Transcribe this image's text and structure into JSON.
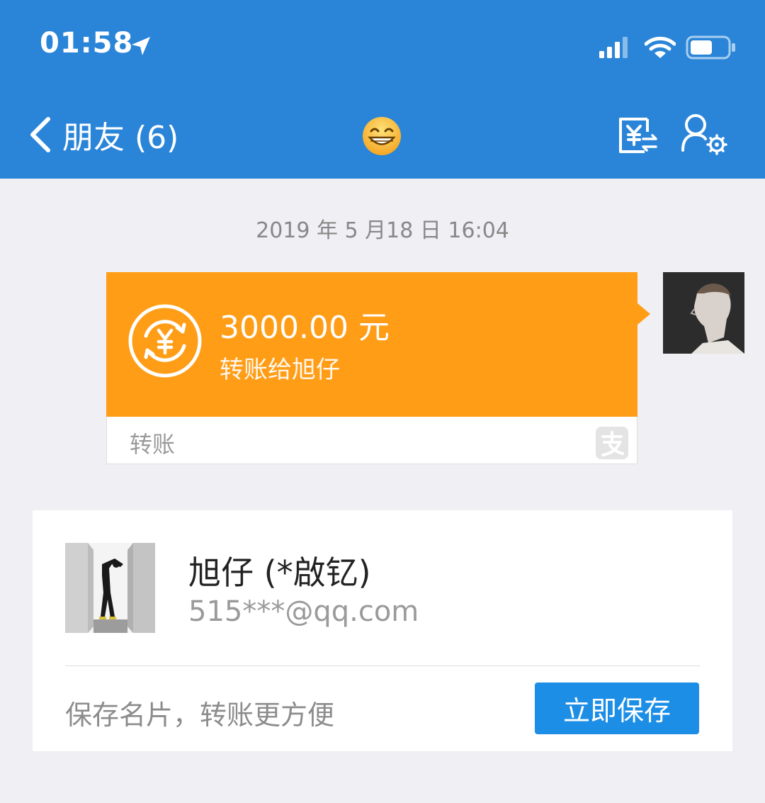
{
  "status_bar": {
    "time": "01:58",
    "icons": [
      "location-arrow-icon",
      "signal-icon",
      "wifi-icon",
      "battery-icon"
    ]
  },
  "nav": {
    "back_label": "朋友 (6)",
    "center_emoji": "😁",
    "right_icons": [
      "transfer-yuan-icon",
      "user-settings-icon"
    ]
  },
  "chat": {
    "timestamp": "2019 年 5 月18 日 16:04",
    "transfer": {
      "amount": "3000.00 元",
      "description": "转账给旭仔",
      "footer_label": "转账",
      "bubble_color": "#ff9d17"
    }
  },
  "contact_card": {
    "name": "旭仔 (*啟钇)",
    "account": "515***@qq.com",
    "hint": "保存名片，转账更方便",
    "save_button": "立即保存"
  },
  "colors": {
    "nav_blue": "#2a85d8",
    "button_blue": "#1d8ee6",
    "background": "#efeff4"
  }
}
